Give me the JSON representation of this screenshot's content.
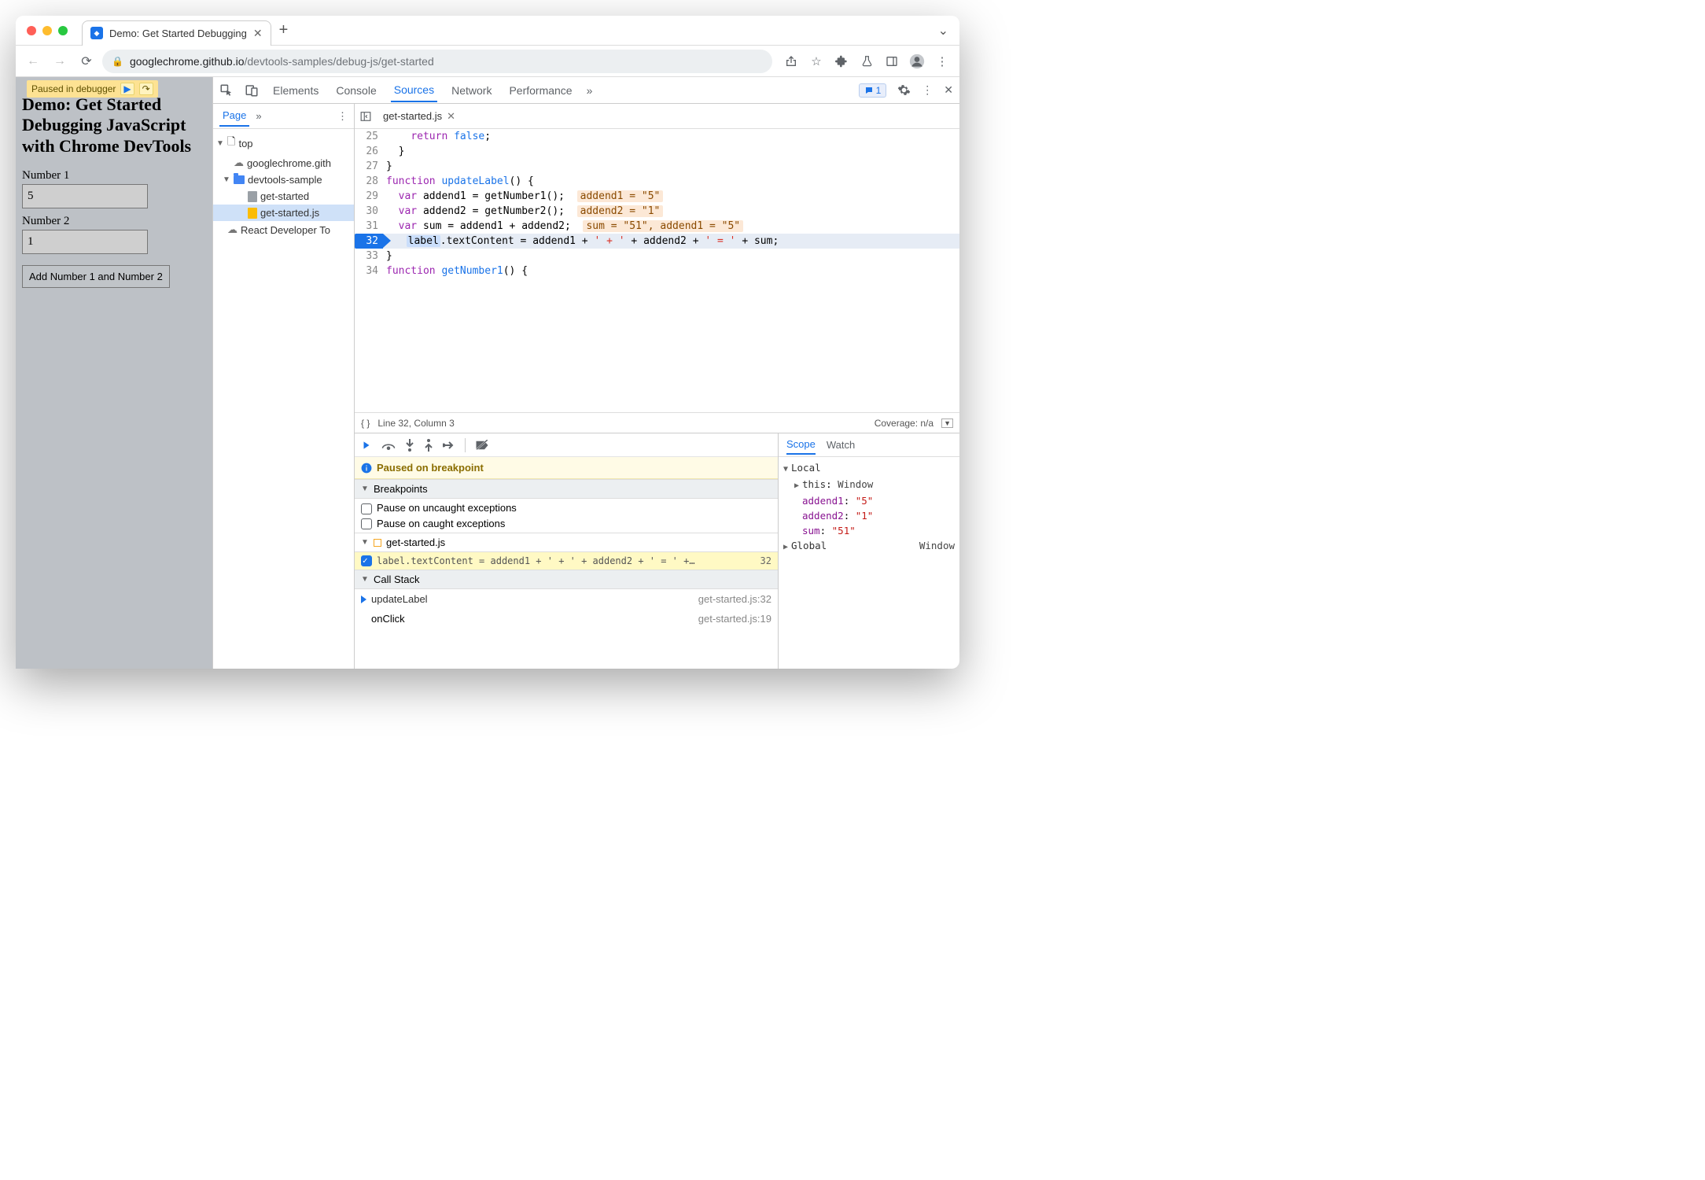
{
  "tab": {
    "title": "Demo: Get Started Debugging"
  },
  "url": {
    "host": "googlechrome.github.io",
    "path": "/devtools-samples/debug-js/get-started"
  },
  "page": {
    "paused_label": "Paused in debugger",
    "heading": "Demo: Get Started Debugging JavaScript with Chrome DevTools",
    "label1": "Number 1",
    "value1": "5",
    "label2": "Number 2",
    "value2": "1",
    "button": "Add Number 1 and Number 2"
  },
  "devtools_tabs": [
    "Elements",
    "Console",
    "Sources",
    "Network",
    "Performance"
  ],
  "devtools_active": "Sources",
  "messages_count": "1",
  "nav": {
    "tabs": [
      "Page"
    ],
    "tree": {
      "top": "top",
      "domain": "googlechrome.gith",
      "folder": "devtools-sample",
      "file_html": "get-started",
      "file_js": "get-started.js",
      "ext": "React Developer To"
    }
  },
  "editor": {
    "open_file": "get-started.js",
    "lines": [
      {
        "n": 25,
        "tokens": [
          [
            "    ",
            ""
          ],
          [
            "return",
            "k-keyword"
          ],
          [
            " ",
            ""
          ],
          [
            "false",
            "k-var"
          ],
          [
            ";",
            ""
          ]
        ]
      },
      {
        "n": 26,
        "tokens": [
          [
            "  }",
            ""
          ]
        ]
      },
      {
        "n": 27,
        "tokens": [
          [
            "}",
            ""
          ]
        ]
      },
      {
        "n": 28,
        "tokens": [
          [
            "function",
            "k-keyword"
          ],
          [
            " ",
            ""
          ],
          [
            "updateLabel",
            "k-def"
          ],
          [
            "() {",
            ""
          ]
        ]
      },
      {
        "n": 29,
        "tokens": [
          [
            "  ",
            ""
          ],
          [
            "var",
            "k-keyword"
          ],
          [
            " addend1 = getNumber1();  ",
            ""
          ]
        ],
        "inline": "addend1 = \"5\""
      },
      {
        "n": 30,
        "tokens": [
          [
            "  ",
            ""
          ],
          [
            "var",
            "k-keyword"
          ],
          [
            " addend2 = getNumber2();  ",
            ""
          ]
        ],
        "inline": "addend2 = \"1\""
      },
      {
        "n": 31,
        "tokens": [
          [
            "  ",
            ""
          ],
          [
            "var",
            "k-keyword"
          ],
          [
            " sum = addend1 + addend2;  ",
            ""
          ]
        ],
        "inline": "sum = \"51\", addend1 = \"5\""
      },
      {
        "n": 32,
        "bp": true,
        "hl": true,
        "tokens": [
          [
            "  ",
            ""
          ],
          [
            "label",
            "label-tok"
          ],
          [
            ".textContent = addend1 + ",
            ""
          ],
          [
            "' + '",
            "k-str"
          ],
          [
            " + addend2 + ",
            ""
          ],
          [
            "' = '",
            "k-str"
          ],
          [
            " + sum;",
            ""
          ]
        ]
      },
      {
        "n": 33,
        "tokens": [
          [
            "}",
            ""
          ]
        ]
      },
      {
        "n": 34,
        "tokens": [
          [
            "function",
            "k-keyword"
          ],
          [
            " ",
            ""
          ],
          [
            "getNumber1",
            "k-def"
          ],
          [
            "() {",
            ""
          ]
        ]
      }
    ],
    "status": "Line 32, Column 3",
    "coverage": "Coverage: n/a"
  },
  "debugger": {
    "paused_on": "Paused on breakpoint",
    "sections": {
      "breakpoints": "Breakpoints",
      "pause_uncaught": "Pause on uncaught exceptions",
      "pause_caught": "Pause on caught exceptions",
      "bp_file": "get-started.js",
      "bp_text": "label.textContent = addend1 + ' + ' + addend2 + ' = ' +…",
      "bp_line": "32",
      "callstack": "Call Stack",
      "frames": [
        {
          "fn": "updateLabel",
          "loc": "get-started.js:32",
          "current": true
        },
        {
          "fn": "onClick",
          "loc": "get-started.js:19",
          "current": false
        }
      ]
    },
    "scope_tabs": [
      "Scope",
      "Watch"
    ],
    "scope": {
      "local": "Local",
      "this_label": "this",
      "this_val": "Window",
      "vars": [
        {
          "name": "addend1",
          "val": "\"5\""
        },
        {
          "name": "addend2",
          "val": "\"1\""
        },
        {
          "name": "sum",
          "val": "\"51\""
        }
      ],
      "global": "Global",
      "global_val": "Window"
    }
  }
}
